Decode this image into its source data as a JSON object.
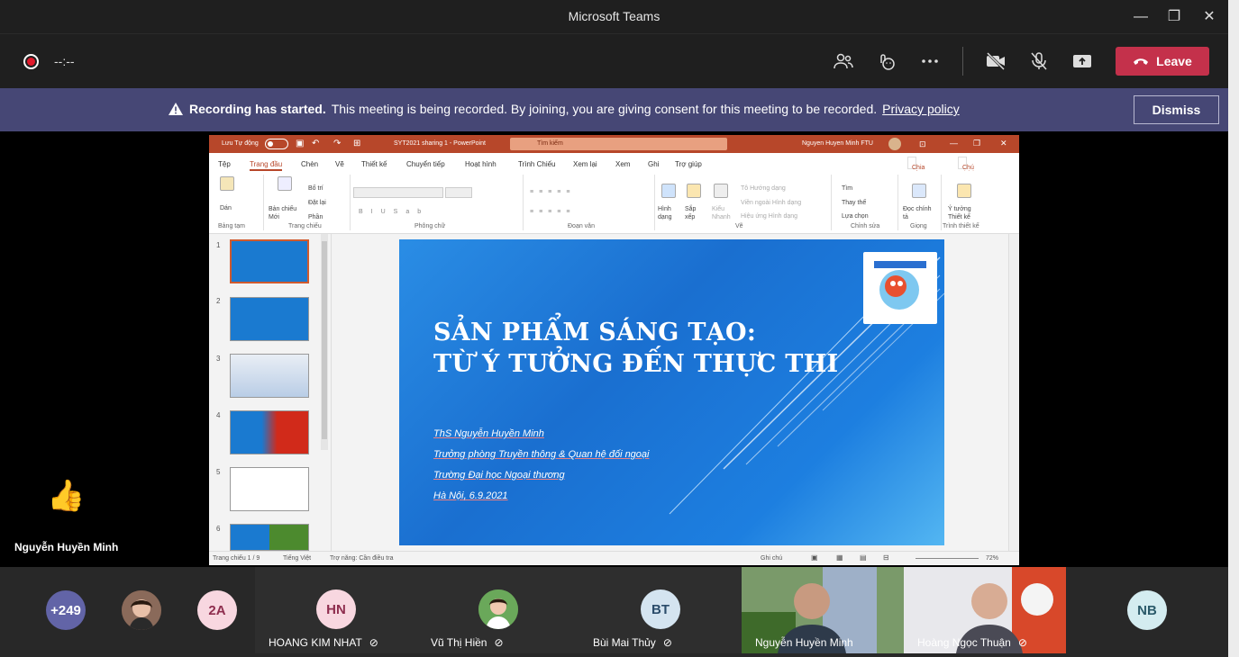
{
  "window": {
    "title": "Microsoft Teams",
    "minimize": "—",
    "maximize": "❐",
    "close": "✕"
  },
  "toolbar": {
    "timer": "--:--",
    "leave_label": "Leave",
    "icons": [
      "people-icon",
      "reactions-icon",
      "more-icon",
      "camera-off-icon",
      "mic-off-icon",
      "share-icon"
    ]
  },
  "banner": {
    "bold": "Recording has started.",
    "text": "This meeting is being recorded. By joining, you are giving consent for this meeting to be recorded.",
    "link": "Privacy policy",
    "dismiss": "Dismiss"
  },
  "presenter": {
    "name": "Nguyễn Huyền Minh",
    "reaction": "👍"
  },
  "ppt": {
    "autosave": "Lưu Tự động",
    "filename": "SYT2021 sharing 1 - PowerPoint",
    "search": "Tìm kiếm",
    "user": "Nguyen Huyen Minh FTU",
    "tabs": [
      "Tệp",
      "Trang đầu",
      "Chèn",
      "Vẽ",
      "Thiết kế",
      "Chuyển tiếp",
      "Hoạt hình",
      "Trình Chiếu",
      "Xem lại",
      "Xem",
      "Ghi",
      "Trợ giúp"
    ],
    "share": "Chia sẻ",
    "comments": "Chú thích",
    "ribbon": {
      "paste": "Dán",
      "new_slide": "Bản chiếu Mới",
      "layout": "Bố trí",
      "reset": "Đặt lại",
      "section": "Phần",
      "shapes": "Hình dạng",
      "arrange": "Sắp xếp",
      "quick": "Kiểu Nhanh",
      "fill": "Tô Hướng dạng",
      "outline": "Viền ngoài Hình dạng",
      "effects": "Hiệu ứng Hình dạng",
      "find": "Tìm",
      "replace": "Thay thế",
      "select": "Lựa chọn",
      "dictate": "Đọc chính tả",
      "designer": "Ý tưởng Thiết kế",
      "groups": [
        "Bảng tạm",
        "Trang chiếu",
        "Phông chữ",
        "Đoạn văn",
        "Vẽ",
        "Chỉnh sửa",
        "Giọng",
        "Trình thiết kế"
      ]
    },
    "slide_numbers": [
      "1",
      "2",
      "3",
      "4",
      "5",
      "6"
    ],
    "slide": {
      "title_line1": "SẢN PHẨM SÁNG TẠO:",
      "title_line2": "TỪ Ý TƯỞNG ĐẾN THỰC THI",
      "author": "ThS Nguyễn Huyền Minh",
      "position": "Trưởng phòng Truyền thông & Quan hệ đối ngoại",
      "org": "Trường Đại học Ngoại thương",
      "date": "Hà Nội, 6.9.2021"
    },
    "status": {
      "slide_count": "Trang chiếu 1 / 9",
      "language": "Tiếng Việt",
      "accessibility": "Trợ năng: Cần điều tra",
      "notes": "Ghi chú",
      "zoom": "72%"
    }
  },
  "participants": {
    "overflow": "+249",
    "initials_2a": "2A",
    "tiles": [
      {
        "initials": "HN",
        "name": "HOANG KIM NHAT"
      },
      {
        "initials": "",
        "name": "Vũ Thị Hiền"
      },
      {
        "initials": "BT",
        "name": "Bùi Mai Thủy"
      }
    ],
    "videos": [
      {
        "name": "Nguyễn Huyền Minh"
      },
      {
        "name": "Hoàng Ngọc Thuận"
      }
    ],
    "nb": "NB"
  },
  "colors": {
    "leave": "#c4314b",
    "banner": "#464775",
    "ppt_accent": "#b7472a"
  }
}
